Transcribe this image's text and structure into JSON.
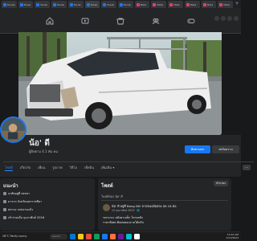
{
  "browser_tabs": [
    {
      "label": "Facebo",
      "favicon_color": "#1877f2"
    },
    {
      "label": "Faceb",
      "favicon_color": "#1877f2"
    },
    {
      "label": "Faceb",
      "favicon_color": "#1877f2"
    },
    {
      "label": "Faceb",
      "favicon_color": "#1877f2"
    },
    {
      "label": "Faceb",
      "favicon_color": "#1877f2"
    },
    {
      "label": "Faceb",
      "favicon_color": "#1877f2",
      "active": true
    },
    {
      "label": "Faceb",
      "favicon_color": "#1877f2"
    },
    {
      "label": "Faceb",
      "favicon_color": "#1877f2"
    },
    {
      "label": "Meta",
      "favicon_color": "#e4405f"
    },
    {
      "label": "Meta",
      "favicon_color": "#e4405f"
    },
    {
      "label": "Meta",
      "favicon_color": "#e4405f"
    },
    {
      "label": "Meta",
      "favicon_color": "#e4405f"
    },
    {
      "label": "Meta",
      "favicon_color": "#e4405f"
    },
    {
      "label": "Meta",
      "favicon_color": "#e4405f"
    }
  ],
  "nav": {
    "icons": [
      "home-icon",
      "video-icon",
      "marketplace-icon",
      "groups-icon",
      "gaming-icon"
    ]
  },
  "profile": {
    "name": "น้อ' ดี",
    "followers": "ผู้ติดตาม 4.1 พัน คน",
    "follow_label": "ติดตามต่อ",
    "message_label": "ส่งข้อความ"
  },
  "profile_tabs": [
    {
      "label": "โพสต์",
      "active": true
    },
    {
      "label": "เกี่ยวกับ"
    },
    {
      "label": "เพื่อน"
    },
    {
      "label": "รูปภาพ"
    },
    {
      "label": "วิดีโอ"
    },
    {
      "label": "เช็คอิน"
    },
    {
      "label": "เพิ่มเติม ▾"
    }
  ],
  "tab_more": "···",
  "intro": {
    "title": "แนะนำ",
    "rows": [
      "อาศัยอยู่ที่ สงขลา",
      "มาจาก จังหวัดนครราชสีมา",
      "สถานะ แต่งงานแล้ว",
      "เข้าร่วมเมื่อ กุมภาพันธ์ 2016"
    ]
  },
  "posts": {
    "title": "โพสต์",
    "filter_label": "ตัวกรอง",
    "composer_hint": "โพสต์ของ น้อ' ดี",
    "post": {
      "author_line": "น้อ' ดี อยู่ที่ Bang Dhi ขายของมือสอง ลด 16 ต่อ",
      "time": "13 กุมภาพันธ์ 2023 · 🌐",
      "lines": [
        "รถกระบะ หลังคาเหล็ก โครงหลัง",
        "ราคาพิเศษ ติดต่อสอบถามได้ครับ"
      ]
    }
  },
  "taskbar": {
    "weather": "28°C Partly sunny",
    "search_placeholder": "Search",
    "time": "10:42 AM",
    "date": "2/13/2023",
    "app_colors": [
      "#0078d4",
      "#f2c811",
      "#e74c3c",
      "#0f9d58",
      "#1877f2",
      "#ff7043",
      "#6a1b9a",
      "#00bcd4",
      "#ffffff"
    ]
  }
}
